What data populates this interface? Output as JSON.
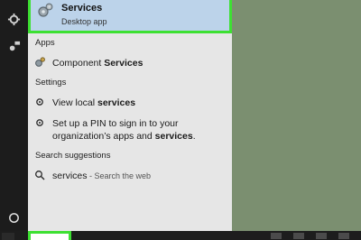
{
  "best_match": {
    "title": "Services",
    "subtitle": "Desktop app",
    "icon": "gears-icon"
  },
  "sections": {
    "apps": "Apps",
    "settings": "Settings",
    "search_suggestions": "Search suggestions"
  },
  "apps": [
    {
      "prefix": "Component ",
      "highlight": "Services",
      "icon": "component-services-icon"
    }
  ],
  "settings": [
    {
      "line1_prefix": "View local ",
      "line1_highlight": "services",
      "icon": "gear-icon"
    },
    {
      "line1": "Set up a PIN to sign in to your",
      "line2_prefix": "organization’s apps and ",
      "line2_highlight": "services",
      "line2_suffix": ".",
      "icon": "gear-icon"
    }
  ],
  "web": {
    "term": "services",
    "hint": " - Search the web",
    "icon": "search-icon"
  },
  "colors": {
    "highlight_border": "#3de032",
    "selected_bg": "#bcd3ea",
    "panel_bg": "#e6e6e6"
  }
}
